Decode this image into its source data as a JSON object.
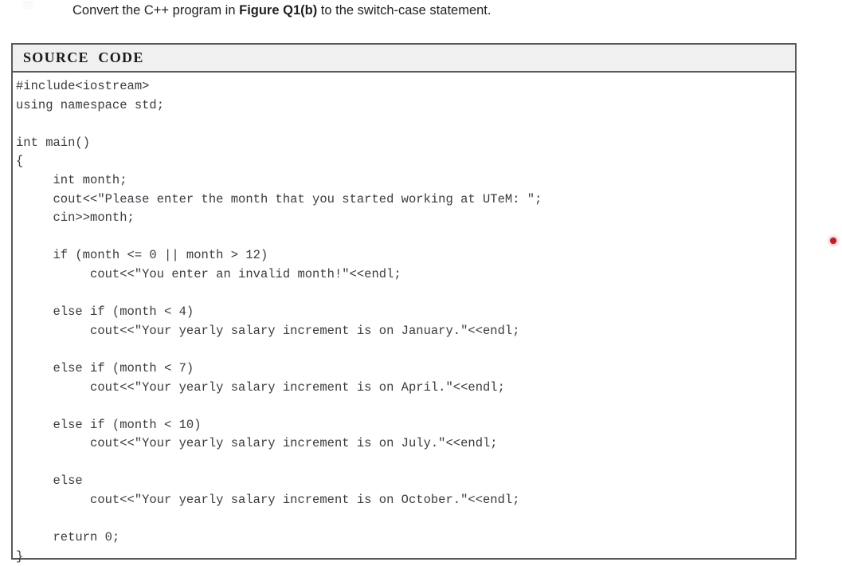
{
  "question": {
    "prefix": "Convert the C++ program in ",
    "figure_ref": "Figure Q1(b)",
    "suffix": " to the switch-case statement."
  },
  "source_code_table": {
    "header_label": "SOURCE  CODE",
    "header_bg": "#f0f0f0",
    "border_color": "#595959",
    "code_color": "#3b3b41",
    "lines": [
      "#include<iostream>",
      "using namespace std;",
      "",
      "int main()",
      "{",
      "     int month;",
      "     cout<<\"Please enter the month that you started working at UTeM: \";",
      "     cin>>month;",
      "",
      "     if (month <= 0 || month > 12)",
      "          cout<<\"You enter an invalid month!\"<<endl;",
      "",
      "     else if (month < 4)",
      "          cout<<\"Your yearly salary increment is on January.\"<<endl;",
      "",
      "     else if (month < 7)",
      "          cout<<\"Your yearly salary increment is on April.\"<<endl;",
      "",
      "     else if (month < 10)",
      "          cout<<\"Your yearly salary increment is on July.\"<<endl;",
      "",
      "     else",
      "          cout<<\"Your yearly salary increment is on October.\"<<endl;",
      "",
      "     return 0;",
      "}"
    ]
  },
  "artifacts": {
    "red_dot_color": "#c21a2b"
  }
}
